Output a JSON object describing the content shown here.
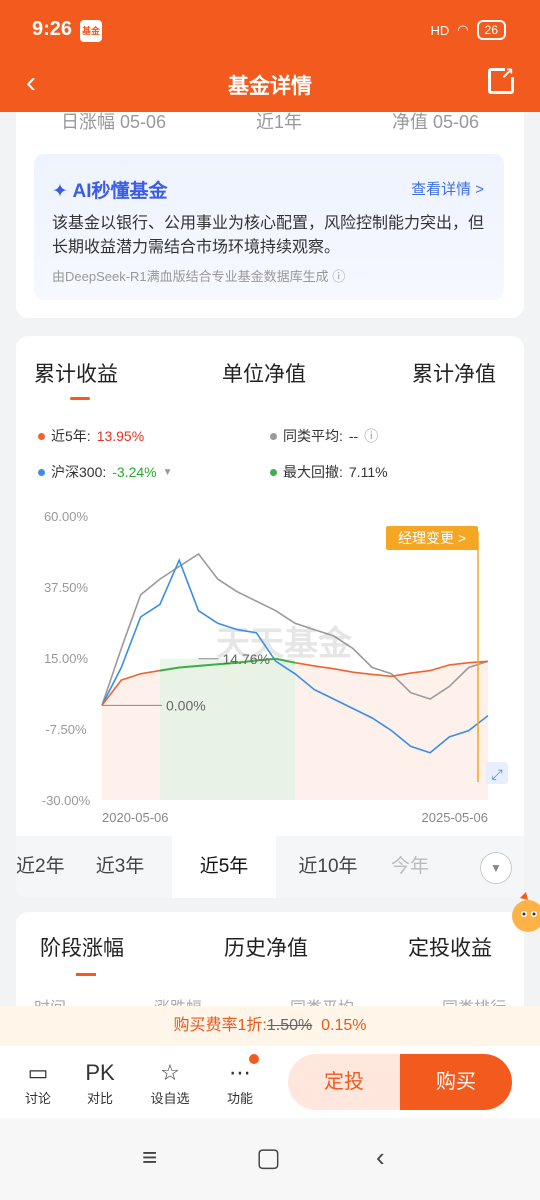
{
  "status": {
    "time": "9:26",
    "app_badge": "基金",
    "network": "HD",
    "battery": "26"
  },
  "header": {
    "title": "基金详情"
  },
  "summary_row": {
    "items": [
      "日涨幅 05-06",
      "近1年",
      "净值 05-06"
    ]
  },
  "ai": {
    "title": "AI秒懂基金",
    "more": "查看详情 >",
    "text": "该基金以银行、公用事业为核心配置，风险控制能力突出，但长期收益潜力需结合市场环境持续观察。",
    "source": "由DeepSeek-R1满血版结合专业基金数据库生成"
  },
  "chart_tabs": [
    "累计收益",
    "单位净值",
    "累计净值"
  ],
  "legend": {
    "fund_label": "近5年:",
    "fund_value": "13.95%",
    "avg_label": "同类平均:",
    "avg_value": "--",
    "index_label": "沪深300:",
    "index_value": "-3.24%",
    "dd_label": "最大回撤:",
    "dd_value": "7.11%"
  },
  "annotations": {
    "manager_change": "经理变更 >",
    "watermark": "天天基金",
    "high": "14.76%",
    "base": "0.00%"
  },
  "periods": [
    "近2年",
    "近3年",
    "近5年",
    "近10年",
    "今年"
  ],
  "section3": {
    "tabs": [
      "阶段涨幅",
      "历史净值",
      "定投收益"
    ],
    "cols": [
      "时间",
      "涨跌幅",
      "同类平均",
      "同类排行"
    ]
  },
  "promo": {
    "prefix": "购买费率1折:",
    "old": "1.50%",
    "new": "0.15%"
  },
  "bottom": {
    "items": [
      "讨论",
      "对比",
      "设自选",
      "功能"
    ],
    "pk": "PK",
    "invest": "定投",
    "buy": "购买"
  },
  "colors": {
    "brand": "#f25a1e",
    "fund": "#f0642d",
    "index": "#3a8ee6",
    "avg": "#9a9a9a",
    "drawdown": "#3cb04a"
  },
  "chart_data": {
    "type": "line",
    "x_start": "2020-05-06",
    "x_end": "2025-05-06",
    "ylim": [
      -30,
      60
    ],
    "ytick_labels": [
      "60.00%",
      "37.50%",
      "15.00%",
      "-7.50%",
      "-30.00%"
    ],
    "series": [
      {
        "name": "近5年",
        "values": [
          0,
          8,
          10,
          11,
          12,
          12.5,
          13,
          13.5,
          14.2,
          14.76,
          13.5,
          12.5,
          11.6,
          10.5,
          9.8,
          9.2,
          10.2,
          11,
          12.8,
          13.5,
          13.95
        ]
      },
      {
        "name": "沪深300",
        "values": [
          0,
          12,
          28,
          32,
          46,
          30,
          26,
          24,
          23,
          14,
          10,
          5,
          2,
          -1,
          -4,
          -8,
          -13,
          -15,
          -10,
          -8,
          -3.24
        ]
      },
      {
        "name": "同类平均",
        "values": [
          0,
          18,
          35,
          40,
          44,
          48,
          40,
          36,
          33,
          30,
          26,
          24,
          22,
          18,
          12,
          10,
          4,
          2,
          6,
          12,
          14
        ]
      }
    ]
  }
}
